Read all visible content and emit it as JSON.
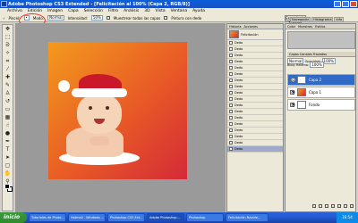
{
  "window": {
    "title": "Adobe Photoshop CS3 Extended - [Felicitación al 100% (Capa 2, RGB/8)]"
  },
  "menu": [
    "Archivo",
    "Edición",
    "Imagen",
    "Capa",
    "Selección",
    "Filtro",
    "Análisis",
    "3D",
    "Vista",
    "Ventana",
    "Ayuda"
  ],
  "options": {
    "brush_label": "Pincel:",
    "mode_label": "Modo:",
    "mode_value": "Normal",
    "strength_label": "Intensidad:",
    "strength_value": "50%",
    "sample_all": "Muestrear todas las capas",
    "finger": "Pintura con dedo",
    "workspace": "Espacio de trabajo"
  },
  "dock_tabs": [
    "Navegador",
    "Histograma",
    "Info"
  ],
  "history": {
    "tabs": [
      "Historia",
      "Acciones"
    ],
    "snapshot": "Felicitación",
    "items": [
      "Dedo",
      "Dedo",
      "Dedo",
      "Dedo",
      "Dedo",
      "Dedo",
      "Dedo",
      "Dedo",
      "Dedo",
      "Dedo",
      "Dedo",
      "Dedo",
      "Dedo",
      "Dedo",
      "Dedo",
      "Dedo",
      "Dedo",
      "Dedo"
    ],
    "active_index": 17
  },
  "right_panel": {
    "tabs": [
      "Color",
      "Muestras",
      "Estilos"
    ],
    "layer_tabs": [
      "Capas",
      "Canales",
      "Trazados"
    ],
    "blend_mode": "Normal",
    "opacity_label": "Opacidad:",
    "opacity_value": "100%",
    "lock_label": "Bloq:",
    "fill_label": "Relleno:",
    "fill_value": "100%",
    "layers": [
      {
        "name": "Capa 2",
        "selected": true
      },
      {
        "name": "Capa 1",
        "selected": false
      },
      {
        "name": "Fondo",
        "selected": false
      }
    ]
  },
  "taskbar": {
    "start": "inicio",
    "items": [
      "Tutoriales de Photo...",
      "Hotmail - Windows ...",
      "Photoshop CS3 Ext...",
      "Adobe Photoshop...",
      "Photoshop",
      "Felicitación Navide..."
    ],
    "clock": "16:54"
  }
}
